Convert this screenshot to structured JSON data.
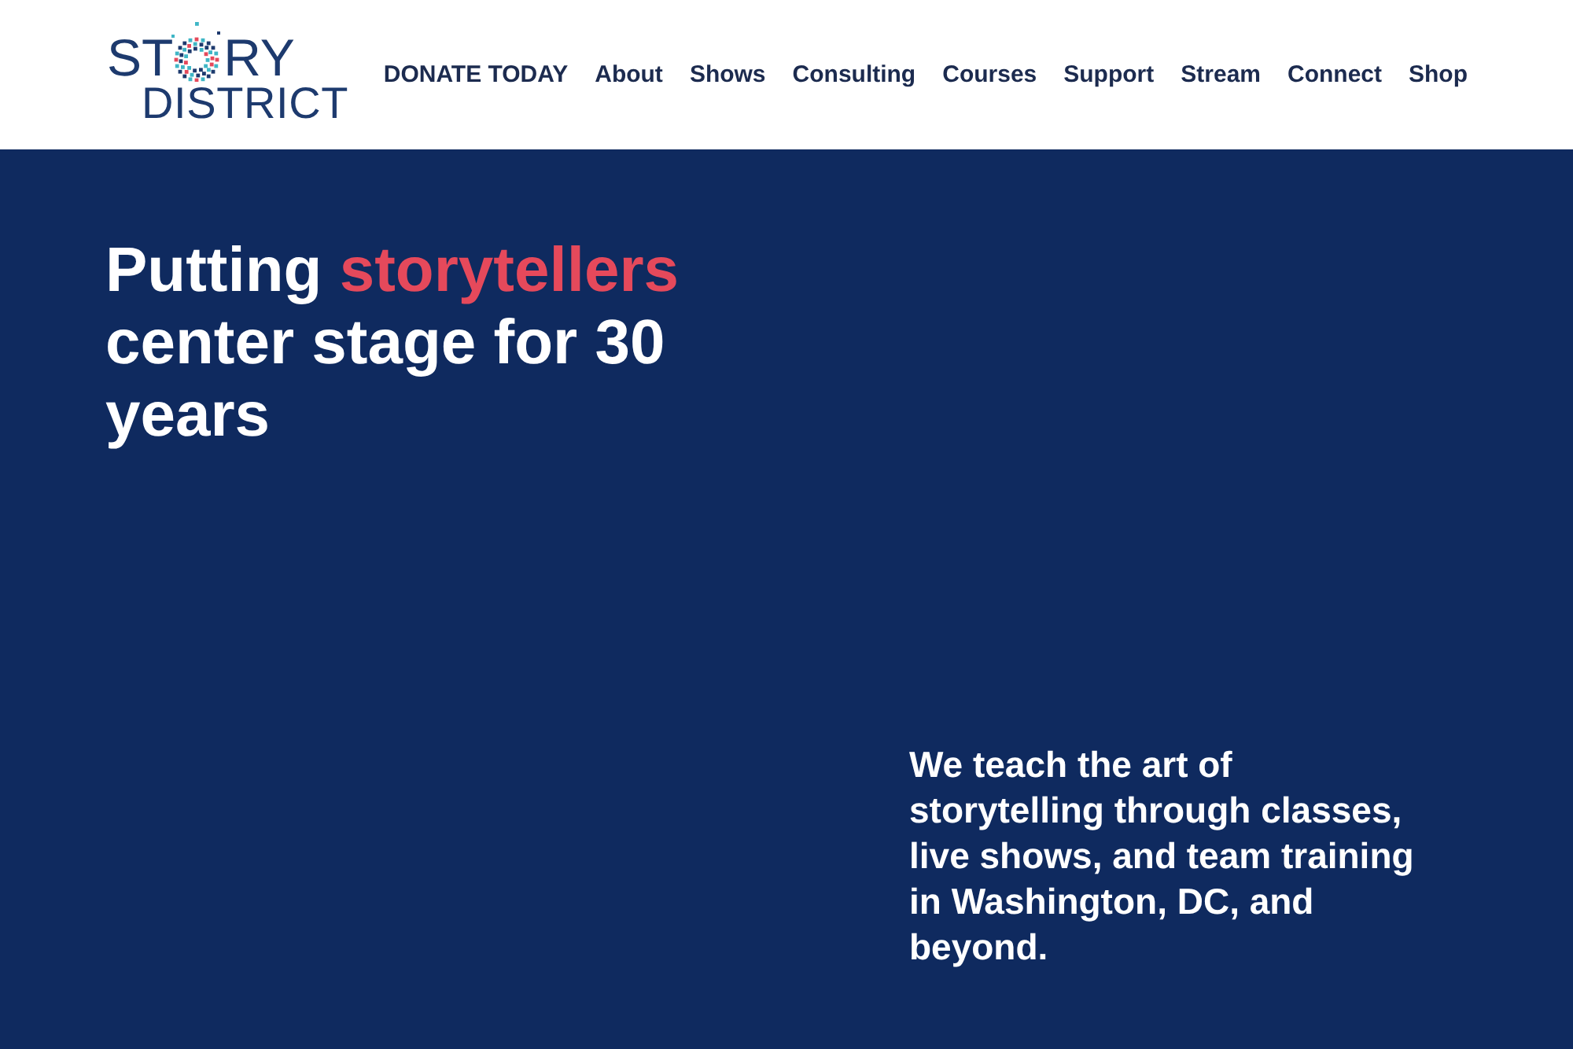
{
  "header": {
    "logo": {
      "line1_left": "ST",
      "line1_right": "RY",
      "line2": "DISTRICT"
    },
    "nav": [
      "DONATE TODAY",
      "About",
      "Shows",
      "Consulting",
      "Courses",
      "Support",
      "Stream",
      "Connect",
      "Shop"
    ]
  },
  "hero": {
    "heading": "Putting **storytellers** center stage for 30 years",
    "text": "We teach the art of storytelling through classes, live shows, and team training in Washington, DC, and beyond."
  }
}
